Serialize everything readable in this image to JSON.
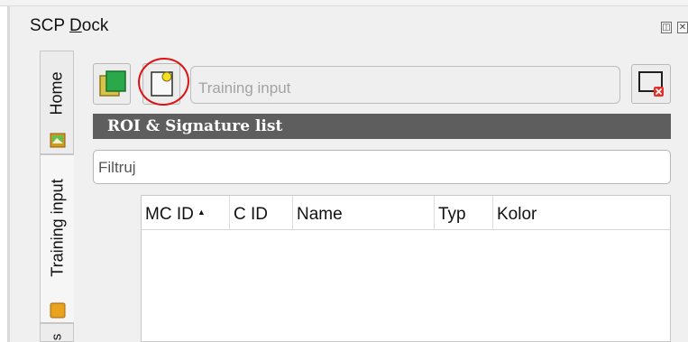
{
  "dock": {
    "title_prefix": "SCP ",
    "title_underlined": "D",
    "title_suffix": "ock",
    "float_symbol": "◫",
    "close_symbol": "✕"
  },
  "tabs": [
    {
      "label": "Home",
      "icon": "home-tab-icon"
    },
    {
      "label": "Training input",
      "icon": "training-tab-icon",
      "active": true
    },
    {
      "label": "s",
      "icon": ""
    }
  ],
  "toolbar": {
    "training_input_placeholder": "Training input",
    "buttons": [
      "create-training-file-icon",
      "open-training-file-icon",
      "remove-training-input-icon"
    ]
  },
  "roi_section": {
    "title": "ROI & Signature list",
    "filter_placeholder": "Filtruj"
  },
  "table": {
    "columns": [
      "MC ID",
      "C ID",
      "Name",
      "Typ",
      "Kolor"
    ],
    "sort_column": "MC ID",
    "sort_indicator": "▲",
    "rows": []
  },
  "annotation": {
    "color": "#e01010",
    "shape": "hand-drawn-circle"
  }
}
